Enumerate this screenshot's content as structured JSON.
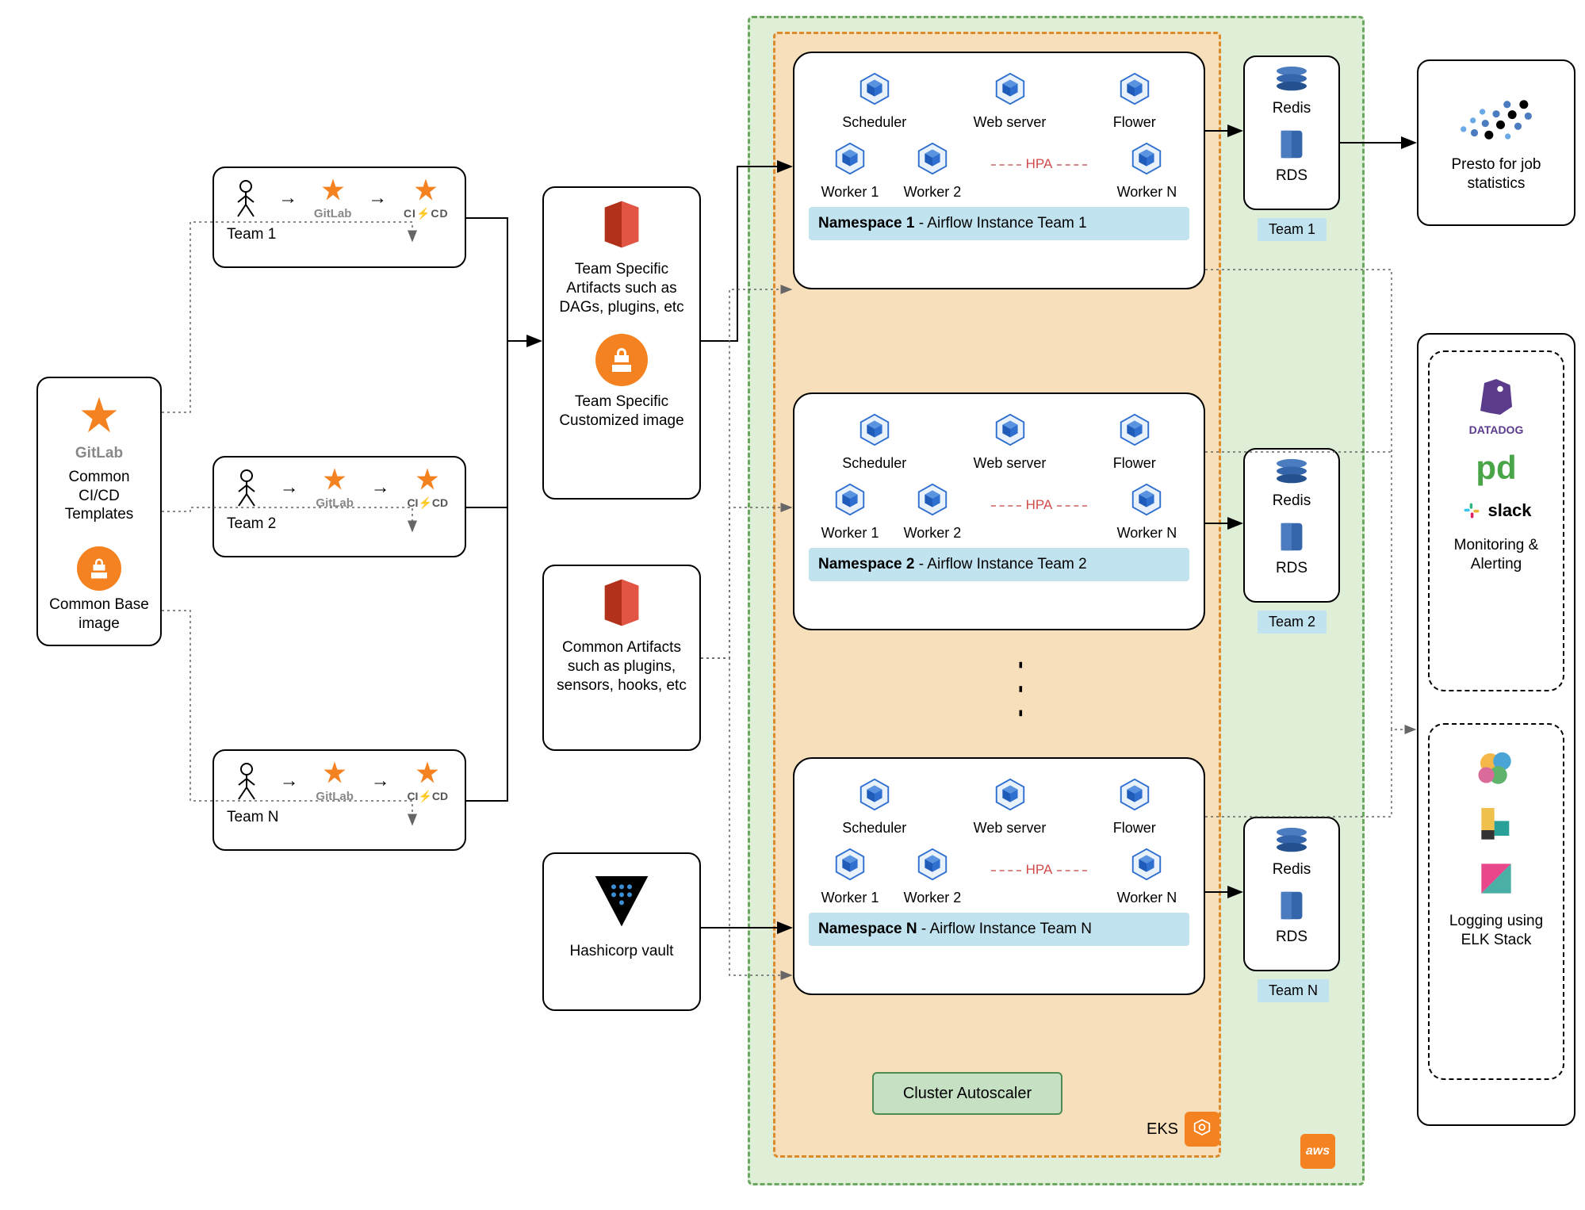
{
  "labels": {
    "gitlab": "GitLab",
    "cicd": "CI/CD",
    "common_cicd": "Common CI/CD Templates",
    "common_base": "Common Base image",
    "team1": "Team 1",
    "team2": "Team 2",
    "teamN": "Team N",
    "team_artifacts": "Team Specific Artifacts such as DAGs, plugins, etc",
    "team_image": "Team Specific Customized image",
    "common_artifacts": "Common Artifacts such as plugins, sensors, hooks, etc",
    "vault": "Hashicorp vault",
    "scheduler": "Scheduler",
    "webserver": "Web server",
    "flower": "Flower",
    "worker1": "Worker 1",
    "worker2": "Worker 2",
    "workerN": "Worker N",
    "hpa": "HPA",
    "ns1_a": "Namespace 1",
    "ns1_b": " -   Airflow Instance Team 1",
    "ns2_a": "Namespace 2",
    "ns2_b": " -   Airflow Instance Team 2",
    "nsN_a": "Namespace N",
    "nsN_b": " -   Airflow Instance Team N",
    "redis": "Redis",
    "rds": "RDS",
    "cluster_autoscaler": "Cluster Autoscaler",
    "eks": "EKS",
    "aws": "aws",
    "presto": "Presto for job statistics",
    "datadog": "DATADOG",
    "pd": "pd",
    "slack": "slack",
    "monitoring": "Monitoring & Alerting",
    "logging": "Logging using ELK Stack"
  }
}
